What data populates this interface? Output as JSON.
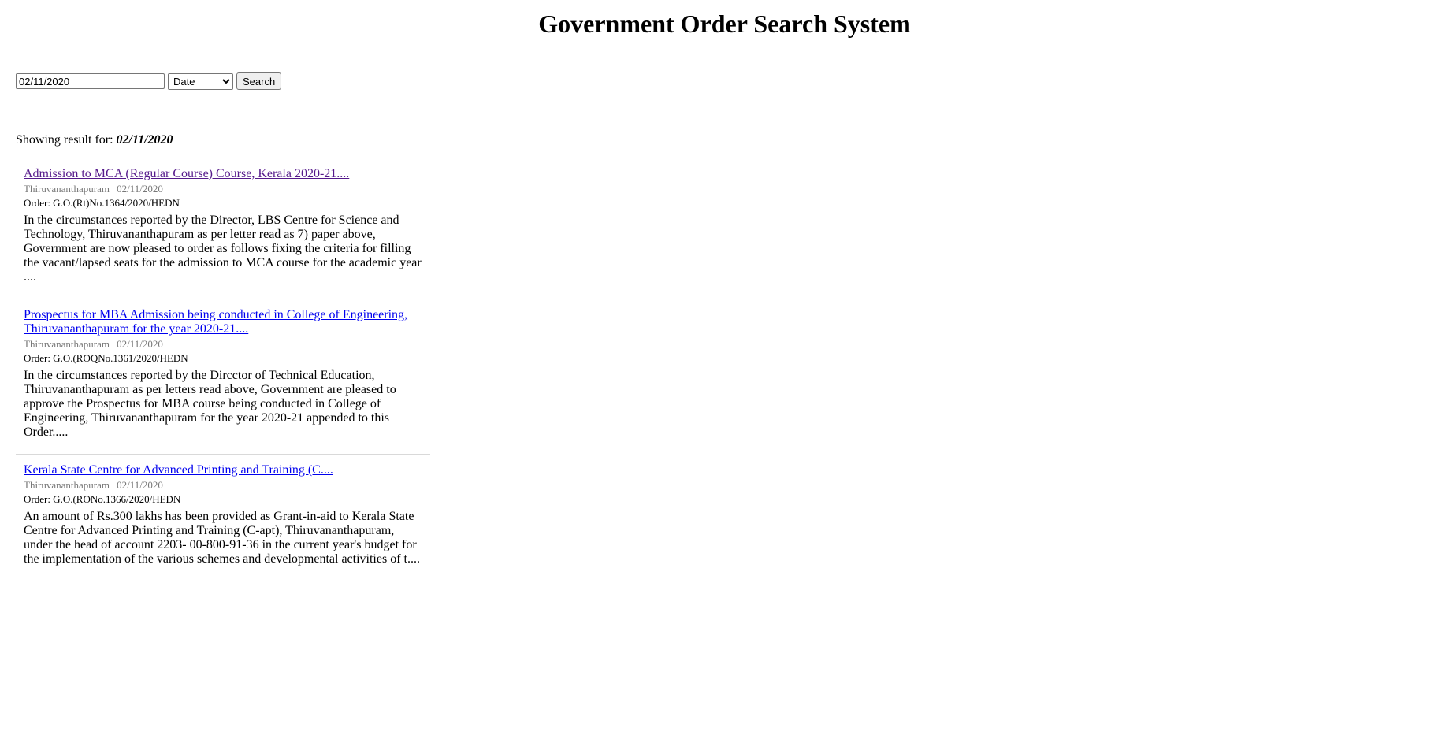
{
  "page": {
    "title": "Government Order Search System"
  },
  "search": {
    "query_value": "02/11/2020",
    "filter_selected": "Date",
    "button_label": "Search"
  },
  "summary": {
    "prefix": "Showing result for:",
    "query": "02/11/2020"
  },
  "results": [
    {
      "title": "Admission to MCA (Regular Course) Course, Kerala 2020-21....",
      "location": "Thiruvananthapuram",
      "separator": "|",
      "date": "02/11/2020",
      "order": "Order: G.O.(Rt)No.1364/2020/HEDN",
      "description": "In the circumstances reported by the Director, LBS Centre for Science and Technology, Thiruvananthapuram as per letter read as 7) paper above, Government are now pleased to order as follows fixing the criteria for filling the vacant/lapsed seats for the admission to MCA course for the academic year ....",
      "visited": true
    },
    {
      "title": "Prospectus for MBA Admission being conducted in College of Engineering, Thiruvananthapuram for the year 2020-21....",
      "location": "Thiruvananthapuram",
      "separator": "|",
      "date": "02/11/2020",
      "order": "Order: G.O.(ROQNo.1361/2020/HEDN",
      "description": "In the circumstances reported by the Dircctor of Technical Education, Thiruvananthapuram as per letters read above, Government are pleased to approve the Prospectus for MBA course being conducted in College of Engineering, Thiruvananthapuram for the year 2020-21 appended to this Order.....",
      "visited": false
    },
    {
      "title": "Kerala State Centre for Advanced Printing and Training (C....",
      "location": "Thiruvananthapuram",
      "separator": "|",
      "date": "02/11/2020",
      "order": "Order: G.O.(RONo.1366/2020/HEDN",
      "description": "An amount of Rs.300 lakhs has been provided as Grant-in-aid to Kerala State Centre for Advanced Printing and Training (C-apt), Thiruvananthapuram, under the head of account 2203- 00-800-91-36 in the current year's budget for the implementation of the various schemes and developmental activities of t....",
      "visited": false
    }
  ]
}
